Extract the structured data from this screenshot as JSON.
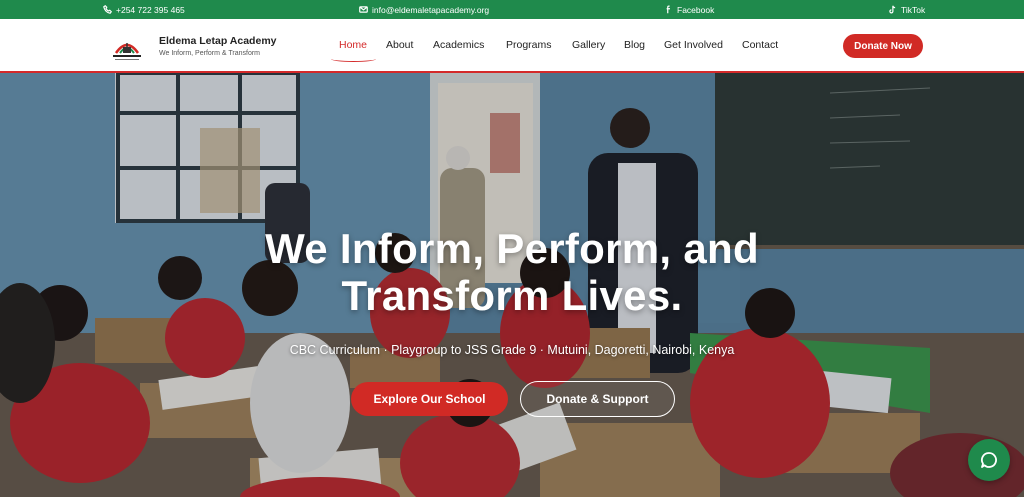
{
  "topbar": {
    "phone": "+254 722 395 465",
    "email": "info@eldemaletapacademy.org",
    "facebook": "Facebook",
    "tiktok": "TikTok"
  },
  "header": {
    "brand_name": "Eldema Letap Academy",
    "brand_tagline": "We Inform, Perform & Transform",
    "nav": [
      "Home",
      "About",
      "Academics",
      "Programs",
      "Gallery",
      "Blog",
      "Get Involved",
      "Contact"
    ],
    "active_nav": "Home",
    "donate_label": "Donate Now"
  },
  "hero": {
    "title_line1": "We Inform, Perform, and",
    "title_line2": "Transform Lives.",
    "subtitle": "CBC Curriculum · Playgroup to JSS Grade 9 · Mutuini, Dagoretti, Nairobi, Kenya",
    "explore_label": "Explore Our School",
    "support_label": "Donate & Support"
  },
  "colors": {
    "brand_green": "#1f8a4c",
    "accent_red": "#d12a25",
    "text_dark": "#222222"
  },
  "icons": {
    "phone": "phone-icon",
    "email": "mail-icon",
    "facebook": "facebook-icon",
    "tiktok": "tiktok-icon",
    "chat": "chat-bubble-icon"
  }
}
